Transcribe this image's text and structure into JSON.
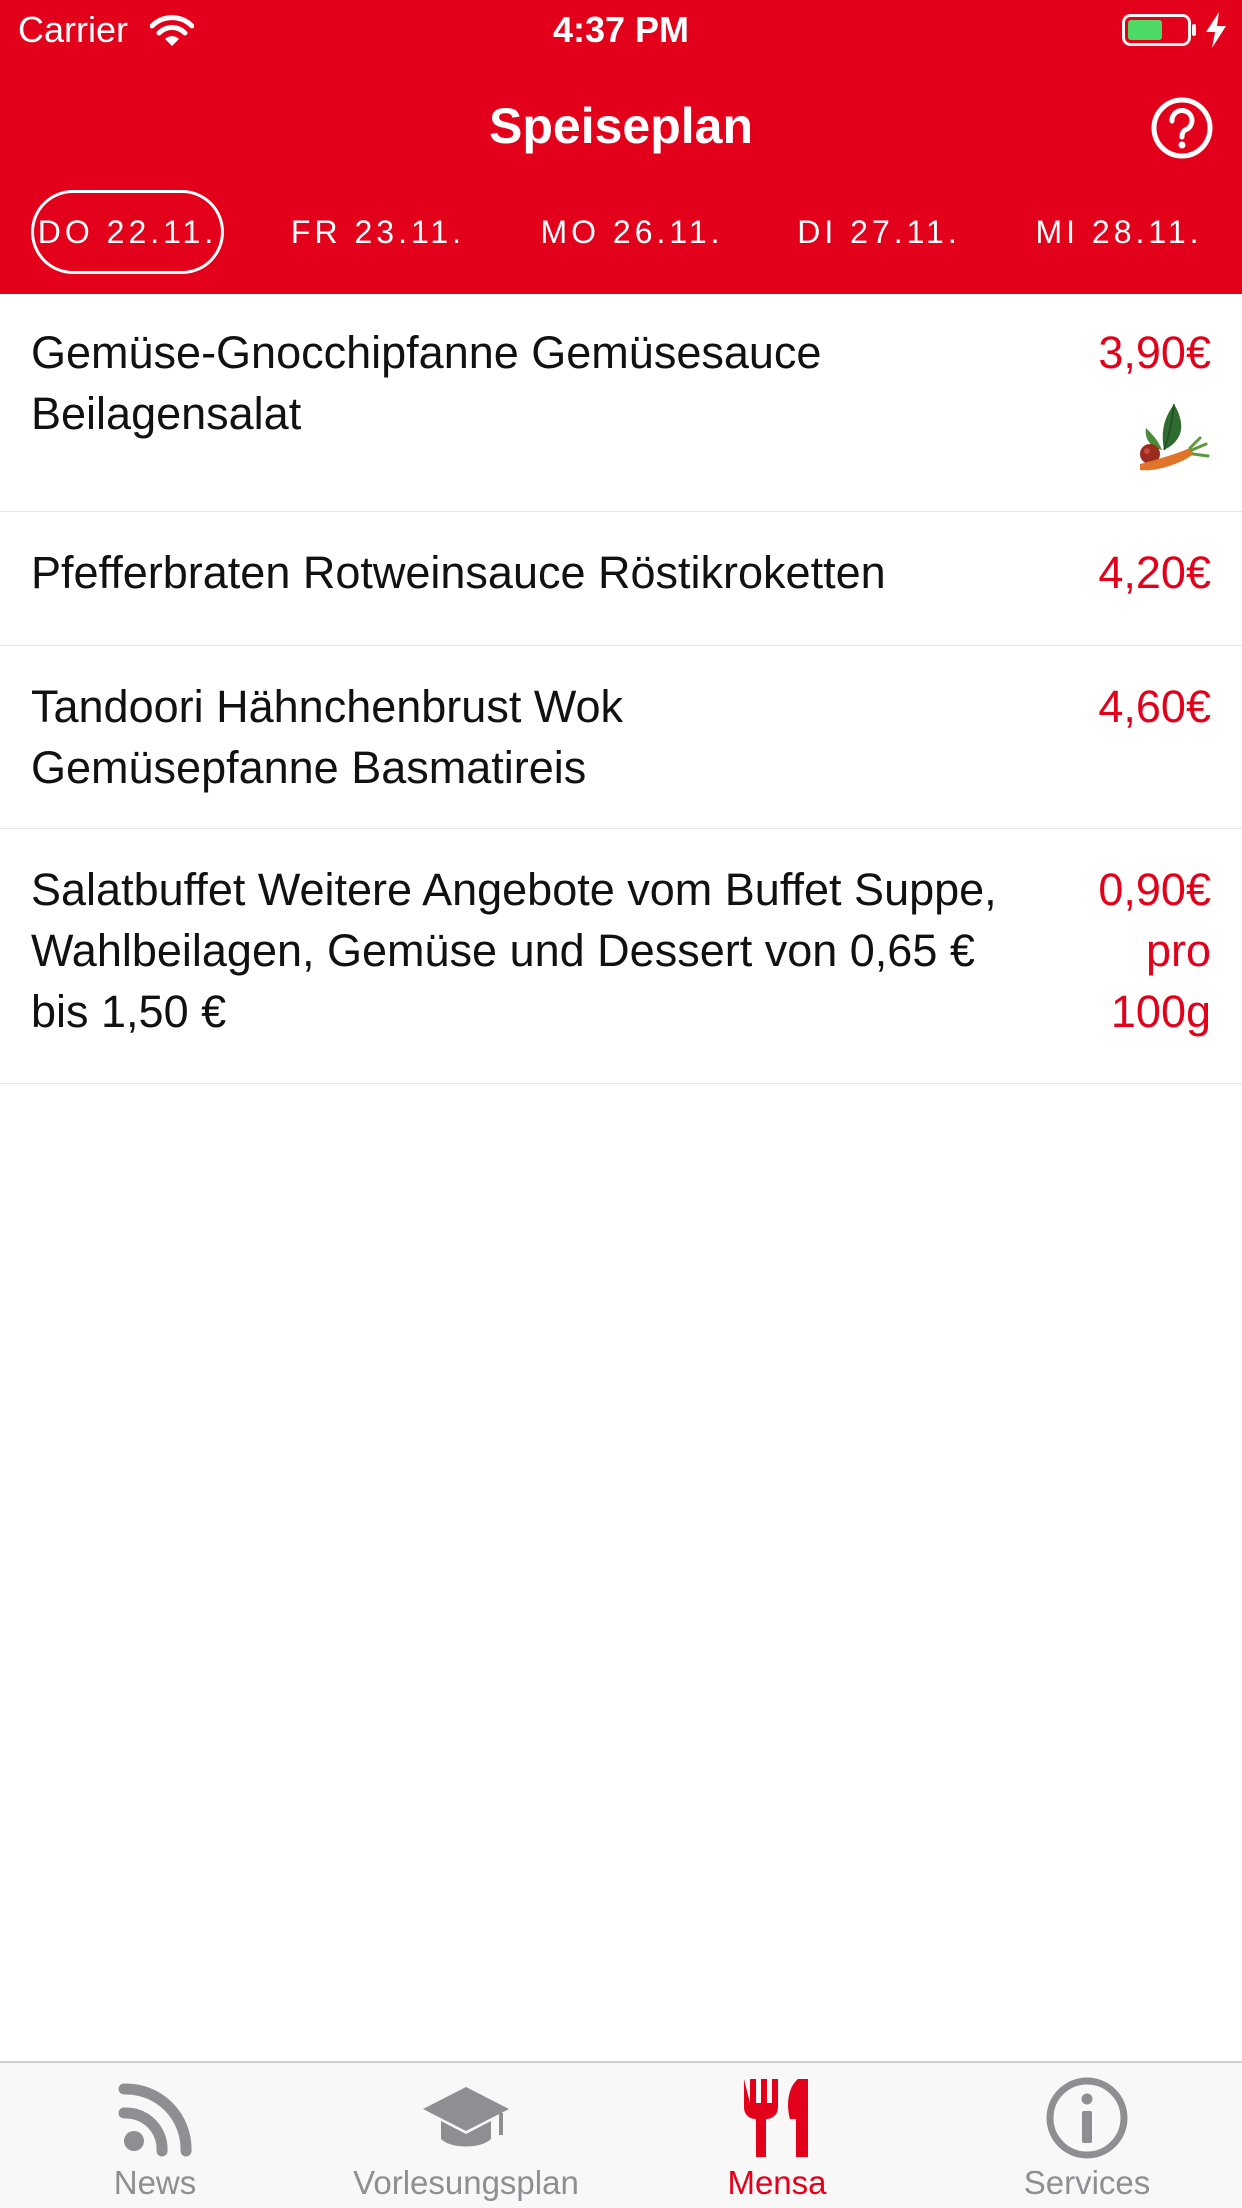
{
  "status_bar": {
    "carrier": "Carrier",
    "time": "4:37 PM"
  },
  "nav": {
    "title": "Speiseplan",
    "help_icon": "help-circle-icon"
  },
  "date_tabs": [
    {
      "label": "DO 22.11.",
      "selected": true
    },
    {
      "label": "FR 23.11.",
      "selected": false
    },
    {
      "label": "MO 26.11.",
      "selected": false
    },
    {
      "label": "DI 27.11.",
      "selected": false
    },
    {
      "label": "MI 28.11.",
      "selected": false
    }
  ],
  "meals": [
    {
      "name": "Gemüse-Gnocchipfanne Gemüsesauce Beilagensalat",
      "price": "3,90€",
      "vegetarian": true
    },
    {
      "name": "Pfefferbraten Rotweinsauce Röstikroketten",
      "price": "4,20€",
      "vegetarian": false
    },
    {
      "name": "Tandoori Hähnchenbrust Wok Gemüsepfanne Basmatireis",
      "price": "4,60€",
      "vegetarian": false
    },
    {
      "name": "Salatbuffet Weitere Angebote vom Buffet Suppe, Wahlbeilagen, Gemüse und Dessert von 0,65 € bis 1,50 €",
      "price": "0,90€ pro 100g",
      "vegetarian": false
    }
  ],
  "tab_bar": {
    "items": [
      {
        "label": "News",
        "icon": "rss-icon",
        "active": false
      },
      {
        "label": "Vorlesungsplan",
        "icon": "graduation-cap-icon",
        "active": false
      },
      {
        "label": "Mensa",
        "icon": "fork-knife-icon",
        "active": true
      },
      {
        "label": "Services",
        "icon": "info-icon",
        "active": false
      }
    ]
  },
  "colors": {
    "brand_red": "#e2001a",
    "tab_inactive": "#8e8e93",
    "battery_green": "#4cd964"
  }
}
